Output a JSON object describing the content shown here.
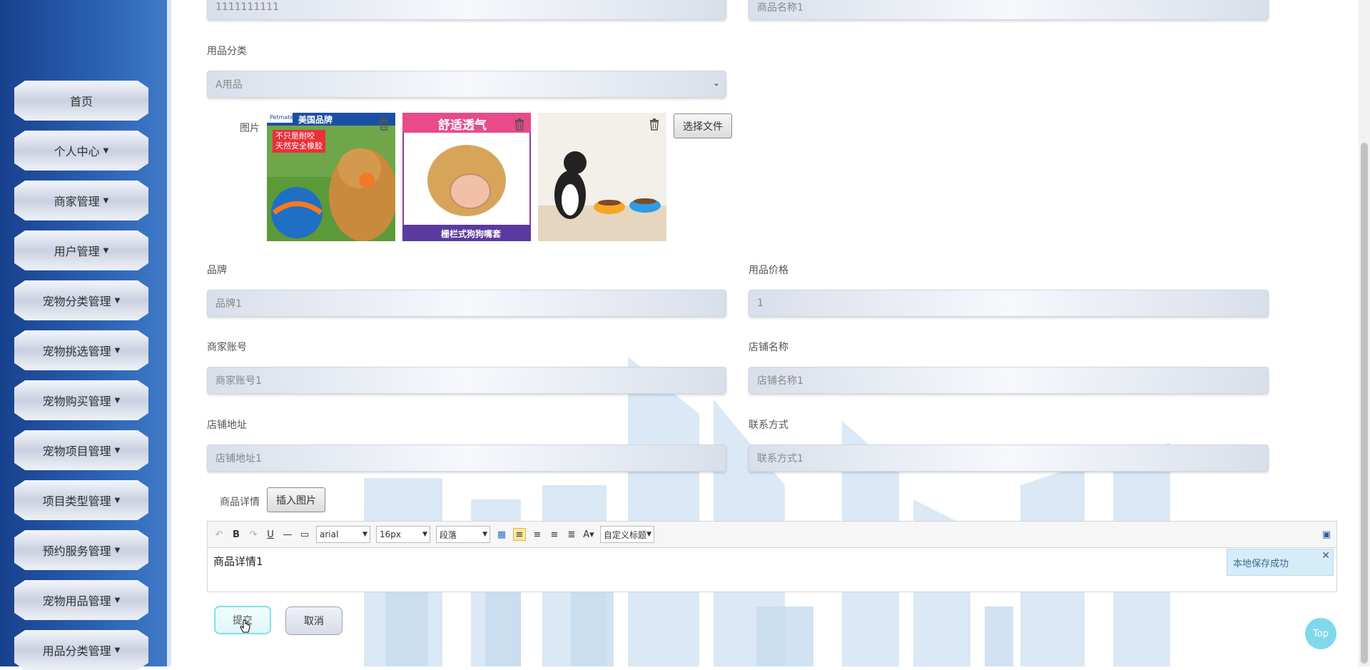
{
  "sidebar": {
    "items": [
      {
        "label": "首页",
        "dropdown": false
      },
      {
        "label": "个人中心",
        "dropdown": true
      },
      {
        "label": "商家管理",
        "dropdown": true
      },
      {
        "label": "用户管理",
        "dropdown": true
      },
      {
        "label": "宠物分类管理",
        "dropdown": true
      },
      {
        "label": "宠物挑选管理",
        "dropdown": true
      },
      {
        "label": "宠物购买管理",
        "dropdown": true
      },
      {
        "label": "宠物项目管理",
        "dropdown": true
      },
      {
        "label": "项目类型管理",
        "dropdown": true
      },
      {
        "label": "预约服务管理",
        "dropdown": true
      },
      {
        "label": "宠物用品管理",
        "dropdown": true
      },
      {
        "label": "用品分类管理",
        "dropdown": true
      }
    ]
  },
  "form": {
    "top_left_value": "1111111111",
    "top_right_value": "商品名称1",
    "category": {
      "label": "用品分类",
      "value": "A用品"
    },
    "images": {
      "label": "图片",
      "choose_file_label": "选择文件",
      "thumbs": [
        {
          "banner": "美国品牌",
          "brand": "Petmate",
          "text1": "不只是耐咬",
          "text2": "天然安全橡胶"
        },
        {
          "banner": "舒适透气",
          "footer": "栅栏式狗狗嘴套"
        },
        {}
      ]
    },
    "brand": {
      "label": "品牌",
      "value": "品牌1"
    },
    "price": {
      "label": "用品价格",
      "value": "1"
    },
    "merchant_account": {
      "label": "商家账号",
      "value": "商家账号1"
    },
    "shop_name": {
      "label": "店铺名称",
      "value": "店铺名称1"
    },
    "shop_address": {
      "label": "店铺地址",
      "value": "店铺地址1"
    },
    "contact": {
      "label": "联系方式",
      "value": "联系方式1"
    },
    "details": {
      "label": "商品详情",
      "insert_image_label": "插入图片"
    }
  },
  "editor": {
    "font_family": "arial",
    "font_size": "16px",
    "paragraph": "段落",
    "custom_heading": "自定义标题",
    "content": "商品详情1",
    "saved_tip": "本地保存成功",
    "close_glyph": "✕"
  },
  "actions": {
    "submit": "提交",
    "cancel": "取消",
    "top": "Top"
  },
  "colors": {
    "sidebar": "#1f4fa0",
    "accent": "#7fe1e6"
  }
}
